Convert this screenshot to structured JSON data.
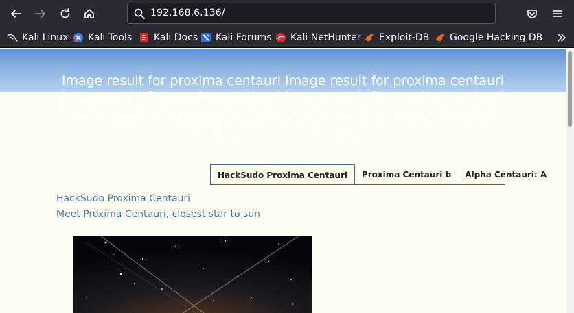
{
  "browser": {
    "url": "192.168.6.136/",
    "icons": [
      "back-arrow-icon",
      "forward-arrow-icon",
      "reload-icon",
      "home-icon",
      "search-icon",
      "pocket-icon",
      "menu-icon"
    ],
    "bookmarks": [
      {
        "label": "Kali Linux",
        "icon": "kali-dragon-icon"
      },
      {
        "label": "Kali Tools",
        "icon": "kali-tools-icon"
      },
      {
        "label": "Kali Docs",
        "icon": "kali-docs-icon"
      },
      {
        "label": "Kali Forums",
        "icon": "kali-forums-icon"
      },
      {
        "label": "Kali NetHunter",
        "icon": "nethunter-icon"
      },
      {
        "label": "Exploit-DB",
        "icon": "exploit-db-icon"
      },
      {
        "label": "Google Hacking DB",
        "icon": "ghdb-icon"
      }
    ]
  },
  "page": {
    "hero_text": "Image result for proxima centauri Image result for proxima centauri Image result for proxima centauri Image result for proxima centauri Image result for proxima centauri Image result for proxima centauri View all Proxima Centauri",
    "tabs": [
      {
        "label": "HackSudo Proxima Centauri",
        "active": true
      },
      {
        "label": "Proxima Centauri b",
        "active": false
      },
      {
        "label": "Alpha Centauri: A",
        "active": false
      }
    ],
    "links": [
      "HackSudo Proxima Centauri",
      "Meet Proxima Centauri, closest star to sun"
    ]
  },
  "colors": {
    "chrome_bg": "#2b2a33",
    "urlbar_bg": "#1c1b22",
    "page_bg": "#fdfdf2",
    "link": "#4a78a8",
    "hero_top": "#5d92d3",
    "tab_border": "#3f6fa0"
  }
}
